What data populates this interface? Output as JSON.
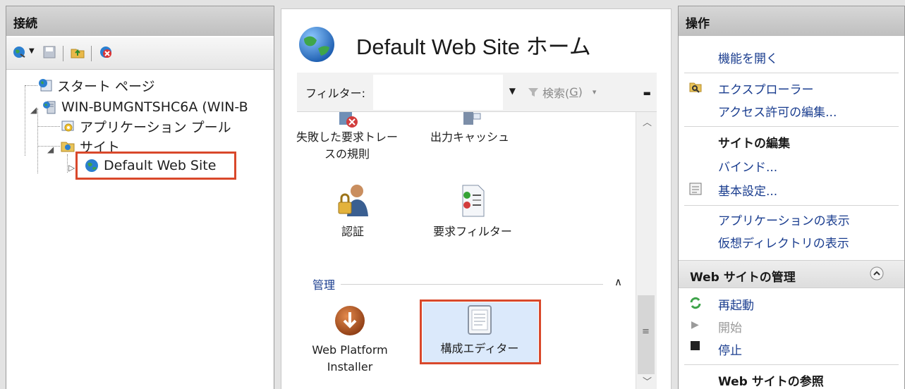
{
  "connections": {
    "header": "接続",
    "tree": [
      {
        "label": "スタート ページ"
      },
      {
        "label": "WIN-BUMGNTSHC6A (WIN-B"
      },
      {
        "label": "アプリケーション プール"
      },
      {
        "label": "サイト"
      },
      {
        "label": "Default Web Site"
      }
    ]
  },
  "center": {
    "title": "Default Web Site ホーム",
    "filter_label": "フィルター:",
    "filter_value": "",
    "search_label_prefix": "検索(",
    "search_label_key": "G",
    "search_label_suffix": ")",
    "features_top": [
      {
        "label_line1": "失敗した要求トレー",
        "label_line2": "スの規則"
      },
      {
        "label_line1": "出力キャッシュ",
        "label_line2": ""
      }
    ],
    "features_mid": [
      {
        "label": "認証"
      },
      {
        "label": "要求フィルター"
      }
    ],
    "group_label": "管理",
    "features_bottom": [
      {
        "label_line1": "Web Platform",
        "label_line2": "Installer"
      },
      {
        "label_line1": "構成エディター",
        "label_line2": ""
      }
    ]
  },
  "actions": {
    "header": "操作",
    "open_feature": "機能を開く",
    "explore": "エクスプローラー",
    "edit_permissions": "アクセス許可の編集...",
    "edit_site_heading": "サイトの編集",
    "bindings": "バインド...",
    "basic_settings": "基本設定...",
    "view_applications": "アプリケーションの表示",
    "view_virtual_dirs": "仮想ディレクトリの表示",
    "manage_heading": "Web サイトの管理",
    "restart": "再起動",
    "start": "開始",
    "stop": "停止",
    "browse_heading": "Web サイトの参照"
  },
  "colors": {
    "accent_red": "#d9482b",
    "link_blue": "#1a3d8f",
    "selected_bg": "#dbe9fb"
  }
}
